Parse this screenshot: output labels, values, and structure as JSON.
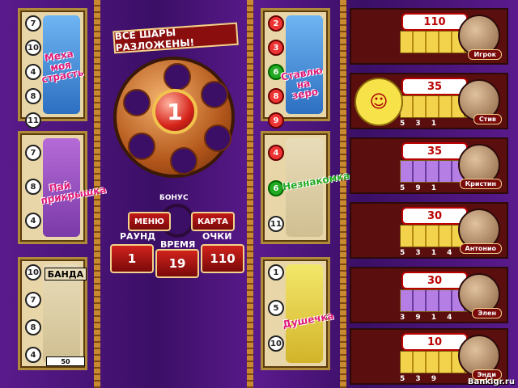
{
  "left_cards": [
    {
      "numbers": [
        "7",
        "10",
        "4",
        "8",
        "11"
      ],
      "title": "Меха моя страсть"
    },
    {
      "numbers": [
        "7",
        "8",
        "4"
      ],
      "title": "Пай прикрышка"
    },
    {
      "numbers": [
        "10",
        "7",
        "8",
        "4"
      ],
      "title": "БАНДА",
      "value": "50"
    }
  ],
  "wheel": {
    "banner": "ВСЕ ШАРЫ РАЗЛОЖЕНЫ!",
    "ball_number": "1",
    "bonus_label": "БОНУС",
    "menu_button": "МЕНЮ",
    "map_button": "КАРТА",
    "round_label": "РАУНД",
    "time_label": "ВРЕМЯ",
    "score_label": "ОЧКИ",
    "round_value": "1",
    "time_value": "19",
    "score_value": "110"
  },
  "right_cards": [
    {
      "numbers": [
        "2",
        "3",
        "6",
        "8",
        "9"
      ],
      "title": "Ставлю на зеро"
    },
    {
      "numbers": [
        "4",
        "6",
        "11"
      ],
      "title": "Незнакомка"
    },
    {
      "numbers": [
        "1",
        "5",
        "10"
      ],
      "title": "Душечка"
    }
  ],
  "players": [
    {
      "name": "Игрок",
      "score": "110",
      "mini": ""
    },
    {
      "name": "Стив",
      "score": "35",
      "mini": "5 3   1"
    },
    {
      "name": "Кристин",
      "score": "35",
      "mini": "5   9 1"
    },
    {
      "name": "Антонио",
      "score": "30",
      "mini": "5 3   1 4"
    },
    {
      "name": "Элен",
      "score": "30",
      "mini": "3 9 1 4"
    },
    {
      "name": "Энди",
      "score": "10",
      "mini": "5 3 9"
    }
  ],
  "watermark": "Bankigr.ru"
}
